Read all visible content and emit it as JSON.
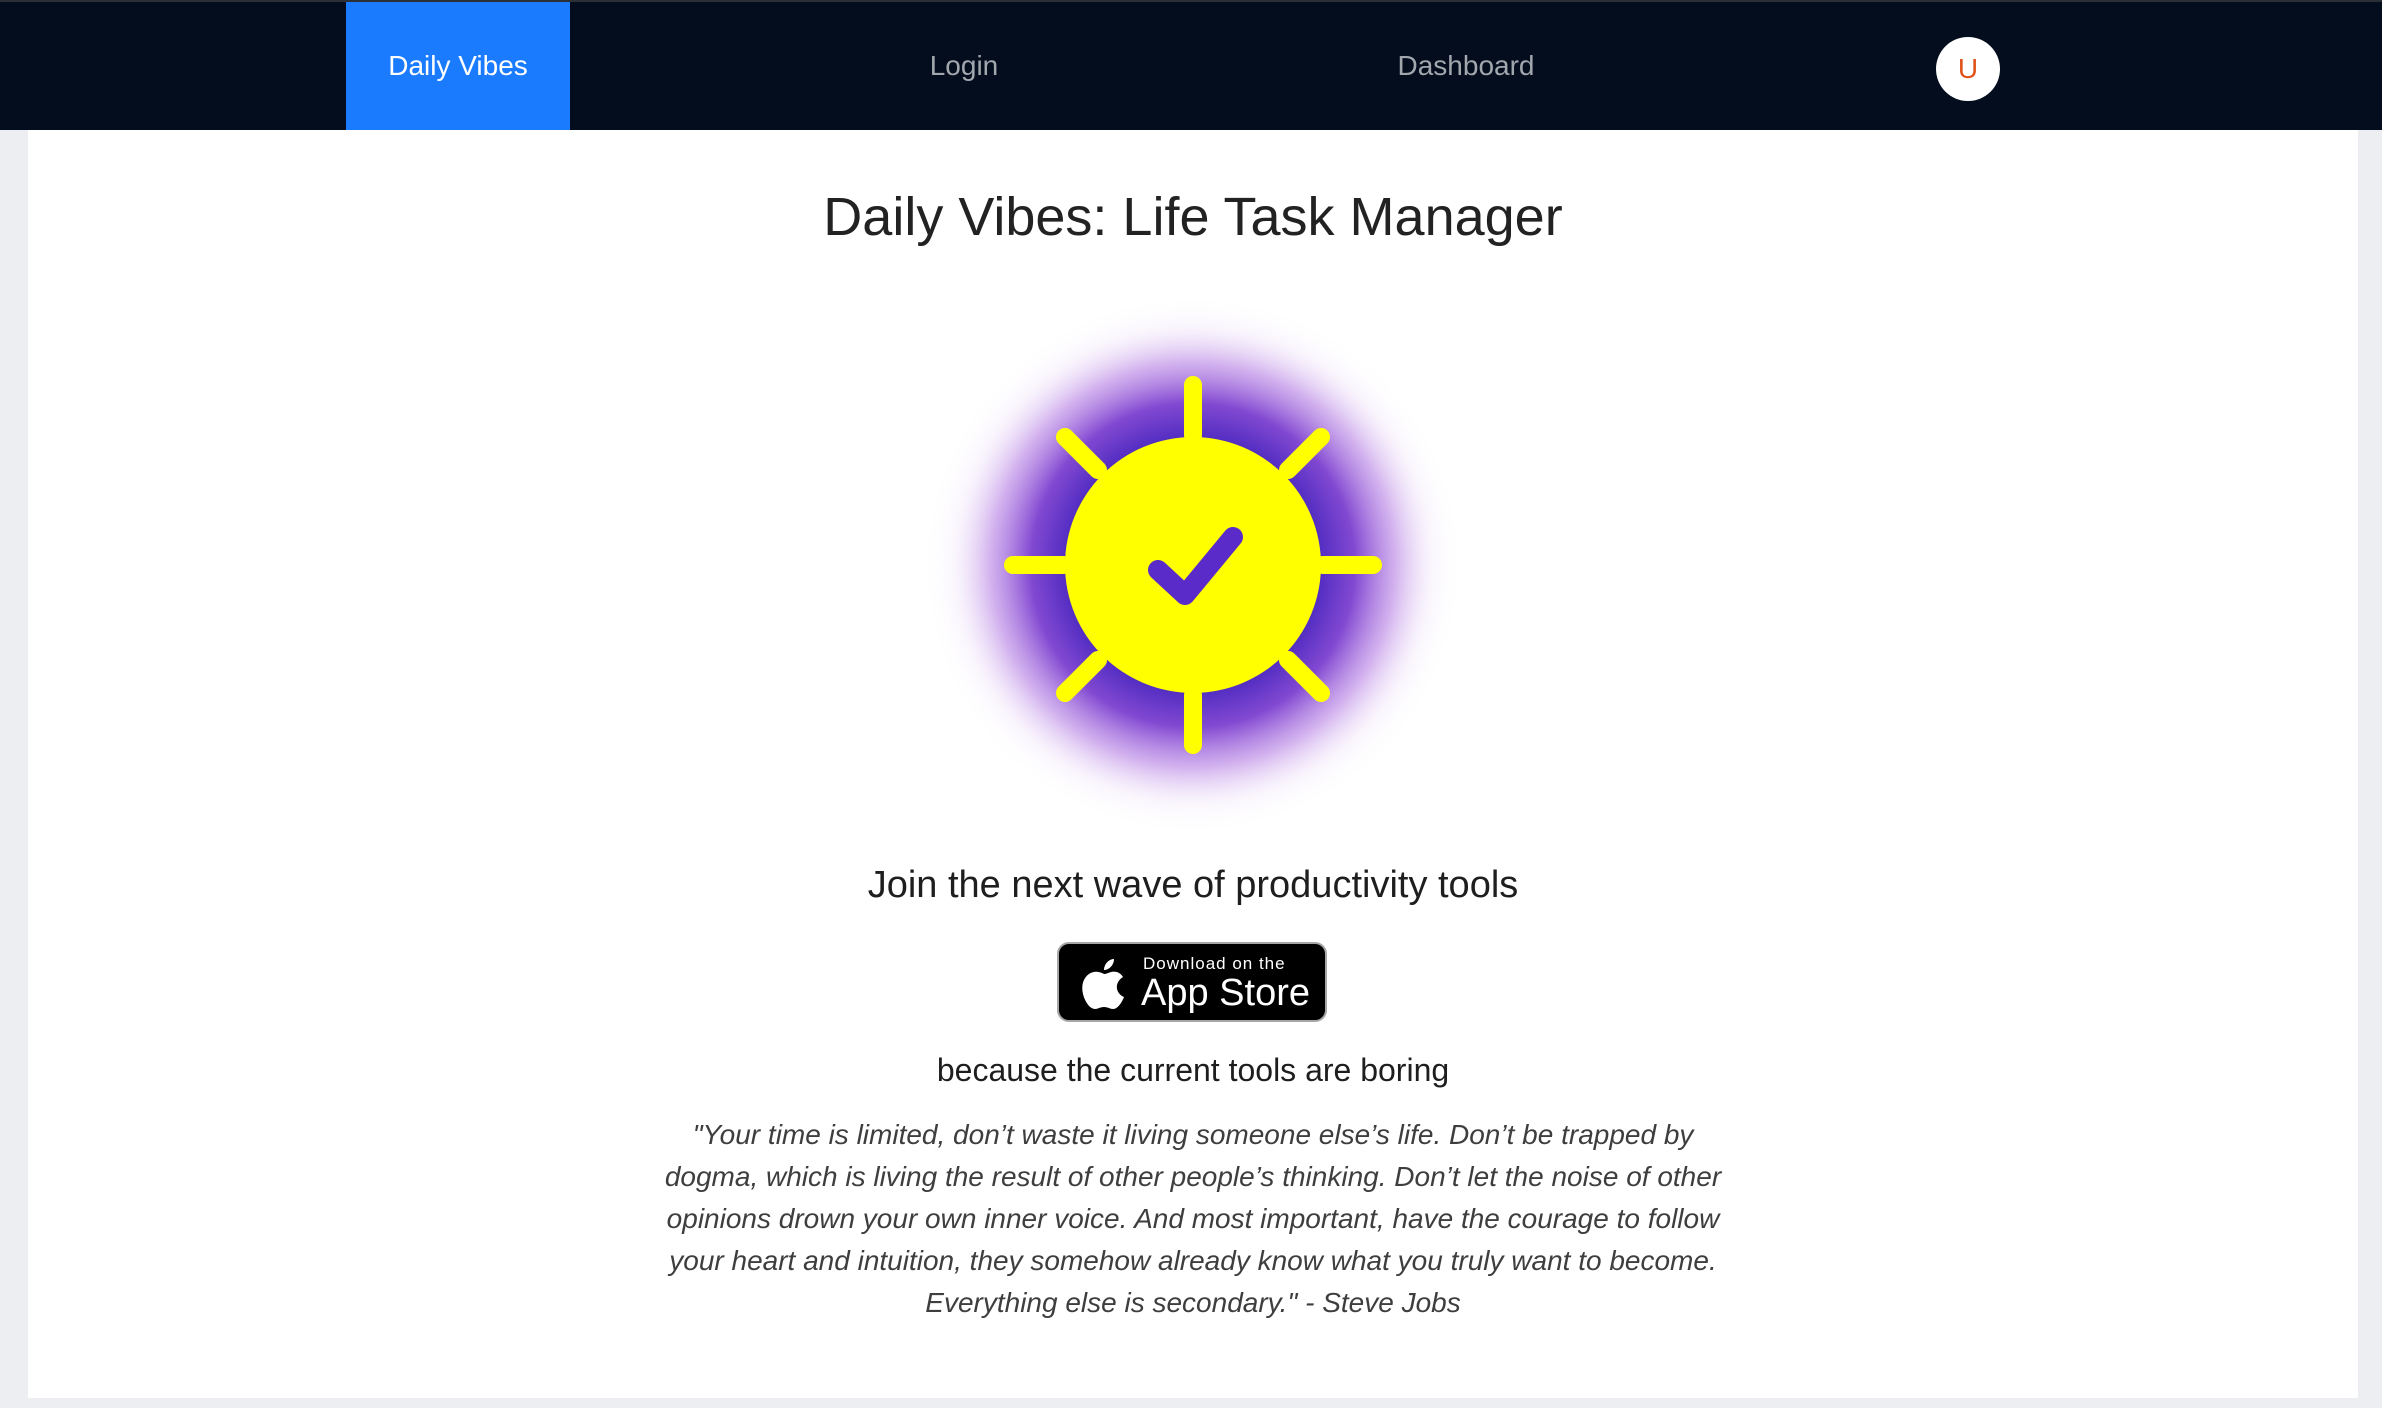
{
  "navbar": {
    "brand_label": "Daily Vibes",
    "login_label": "Login",
    "dashboard_label": "Dashboard",
    "avatar_initial": "U"
  },
  "main": {
    "title": "Daily Vibes: Life Task Manager",
    "logo_icon": "sun-checkmark-icon",
    "tagline": "Join the next wave of productivity tools",
    "appstore_badge": {
      "small_text": "Download on the",
      "large_text": "App Store",
      "icon": "apple-icon"
    },
    "subtagline": "because the current tools are boring",
    "quote": "\"Your time is limited, don’t waste it living someone else’s life. Don’t be trapped by dogma, which is living the result of other people’s thinking. Don’t let the noise of other opinions drown your own inner voice. And most important, have the courage to follow your heart and intuition, they somehow already know what you truly want to become. Everything else is secondary.\" - Steve Jobs"
  },
  "colors": {
    "navbar_bg": "#030d1d",
    "brand_bg": "#1a7bff",
    "sun_yellow": "#ffff00",
    "glow_purple": "#5a2bc8",
    "avatar_text": "#e0541c"
  }
}
